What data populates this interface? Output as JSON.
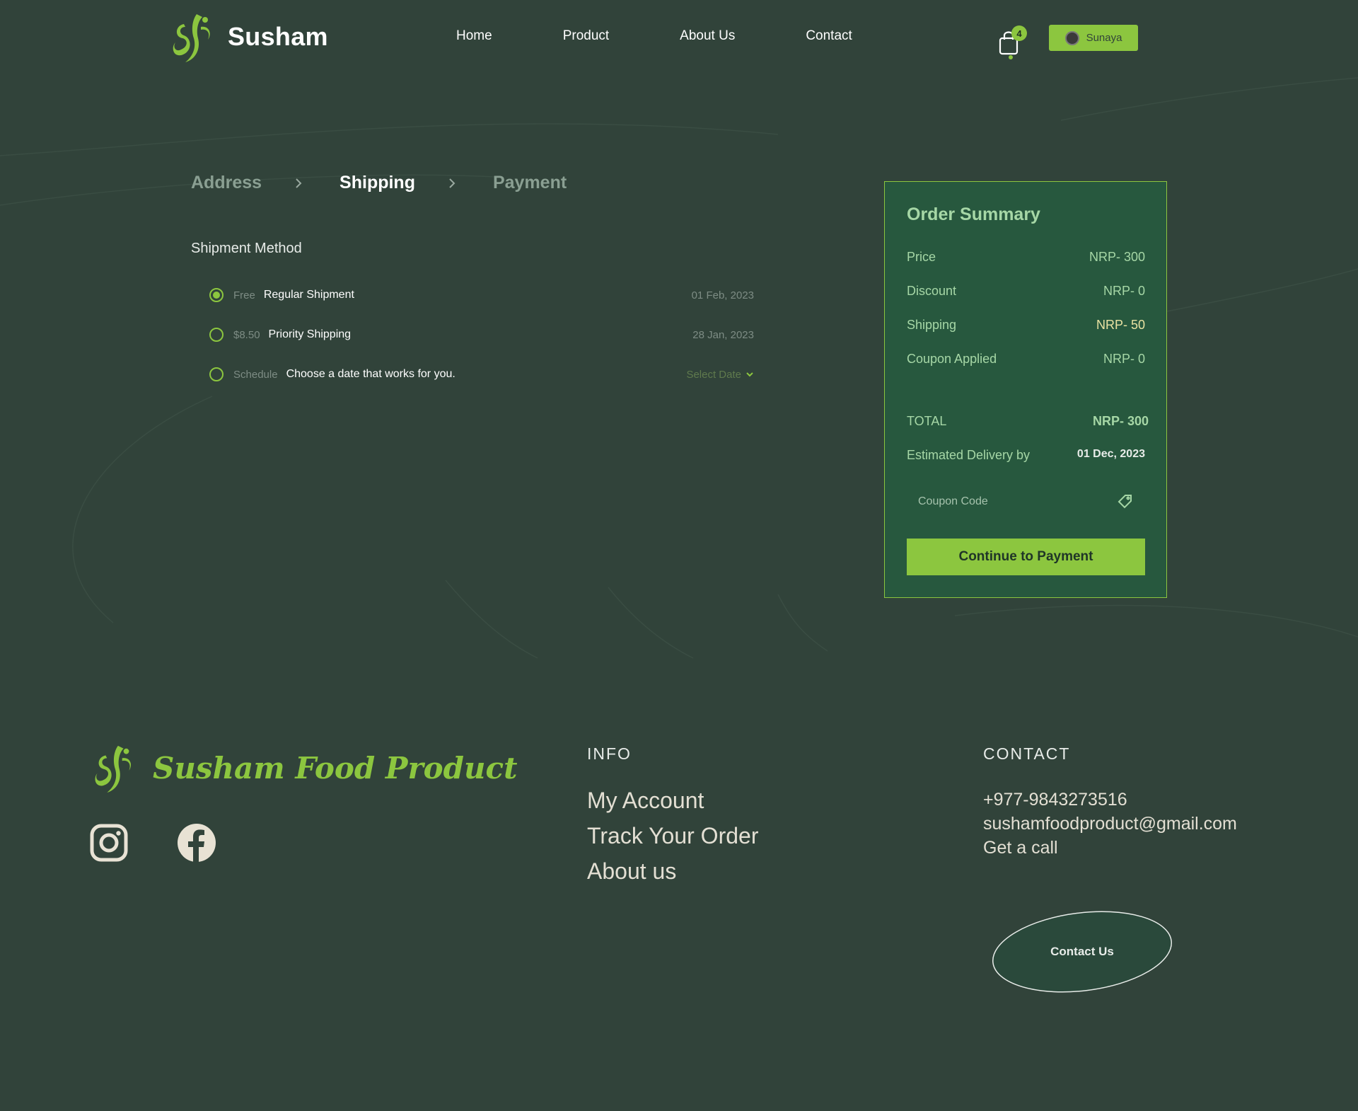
{
  "header": {
    "brand": "Susham",
    "nav": [
      "Home",
      "Product",
      "About Us",
      "Contact"
    ],
    "cart_count": "4",
    "user_name": "Sunaya"
  },
  "steps": [
    "Address",
    "Shipping",
    "Payment"
  ],
  "active_step": "Shipping",
  "shipment": {
    "title": "Shipment Method",
    "options": [
      {
        "price": "Free",
        "name": "Regular Shipment",
        "date": "01 Feb, 2023",
        "selected": true
      },
      {
        "price": "$8.50",
        "name": "Priority Shipping",
        "date": "28 Jan, 2023",
        "selected": false
      },
      {
        "price": "Schedule",
        "name": "Choose a date that works for you.",
        "select_label": "Select Date",
        "selected": false
      }
    ]
  },
  "summary": {
    "title": "Order Summary",
    "rows": [
      {
        "label": "Price",
        "value": "NRP- 300"
      },
      {
        "label": "Discount",
        "value": "NRP- 0"
      },
      {
        "label": "Shipping",
        "value": "NRP- 50"
      },
      {
        "label": "Coupon Applied",
        "value": "NRP- 0"
      }
    ],
    "total_label": "TOTAL",
    "total_value": "NRP- 300",
    "delivery_label": "Estimated Delivery by",
    "delivery_value": "01 Dec, 2023",
    "coupon_placeholder": "Coupon Code",
    "continue_label": "Continue to Payment"
  },
  "footer": {
    "brand": "Susham Food Product",
    "info_title": "INFO",
    "info_links": [
      "My Account",
      "Track Your Order",
      "About us"
    ],
    "contact_title": "CONTACT",
    "phone": "+977-9843273516",
    "email": "sushamfoodproduct@gmail.com",
    "call": "Get a call",
    "contact_button": "Contact Us"
  },
  "colors": {
    "background": "#31433a",
    "accent": "#8cc63f",
    "summary_panel": "#27583e",
    "summary_text": "#a6d7a6"
  },
  "icons": [
    "logo-mark",
    "cart-icon",
    "chevron-right-icon",
    "chevron-down-icon",
    "tag-icon",
    "instagram-icon",
    "facebook-icon"
  ]
}
